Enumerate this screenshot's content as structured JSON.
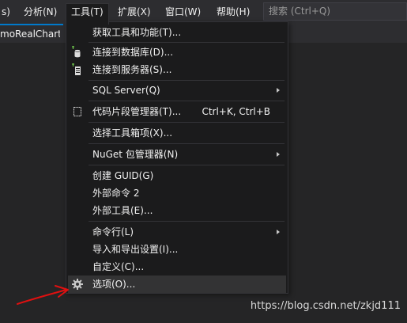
{
  "menubar": {
    "items": [
      {
        "label": "s)"
      },
      {
        "label": "分析(N)"
      },
      {
        "label": "工具(T)"
      },
      {
        "label": "扩展(X)"
      },
      {
        "label": "窗口(W)"
      },
      {
        "label": "帮助(H)"
      }
    ],
    "search_placeholder": "搜索 (Ctrl+Q)"
  },
  "doc_tab": {
    "label": "moRealChart"
  },
  "tools_menu": {
    "items": [
      {
        "label": "获取工具和功能(T)..."
      },
      {
        "label": "连接到数据库(D)...",
        "icon": "database-connect-icon"
      },
      {
        "label": "连接到服务器(S)...",
        "icon": "server-connect-icon"
      },
      {
        "label": "SQL Server(Q)",
        "submenu": true
      },
      {
        "label": "代码片段管理器(T)...",
        "shortcut": "Ctrl+K, Ctrl+B",
        "icon": "code-snippet-icon"
      },
      {
        "label": "选择工具箱项(X)..."
      },
      {
        "label": "NuGet 包管理器(N)",
        "submenu": true
      },
      {
        "label": "创建 GUID(G)"
      },
      {
        "label": "外部命令 2"
      },
      {
        "label": "外部工具(E)..."
      },
      {
        "label": "命令行(L)",
        "submenu": true
      },
      {
        "label": "导入和导出设置(I)..."
      },
      {
        "label": "自定义(C)..."
      },
      {
        "label": "选项(O)...",
        "icon": "gear-icon",
        "highlighted": true
      }
    ]
  },
  "watermark": "https://blog.csdn.net/zkjd111",
  "colors": {
    "background": "#2d2d30",
    "menu_background": "#1b1b1c",
    "menu_highlight": "#333334",
    "accent": "#007acc",
    "annotation_arrow": "#e01010"
  }
}
